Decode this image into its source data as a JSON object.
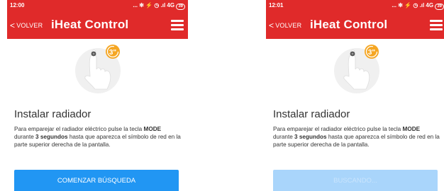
{
  "screens": [
    {
      "status_time": "12:00",
      "status_icons": "... ✻ ⚡ ◷ .ıl 4G",
      "battery": "39",
      "back_label": "VOLVER",
      "app_title": "iHeat Control",
      "badge": "3\"",
      "heading": "Instalar radiador",
      "desc_part1": "Para emparejar el radiador eléctrico pulse la tecla ",
      "desc_mode": "MODE",
      "desc_part2": " durante ",
      "desc_seconds": "3 segundos",
      "desc_part3": " hasta que aparezca el símbolo de red en la parte superior derecha de la pantalla.",
      "button_label": "COMENZAR BÚSQUEDA",
      "button_state": "enabled"
    },
    {
      "status_time": "12:01",
      "status_icons": "... ✻ ⚡ ◷ .ıl 4G",
      "battery": "39",
      "back_label": "VOLVER",
      "app_title": "iHeat Control",
      "badge": "3\"",
      "heading": "Instalar radiador",
      "desc_part1": "Para emparejar el radiador eléctrico pulse la tecla ",
      "desc_mode": "MODE",
      "desc_part2": " durante ",
      "desc_seconds": "3 segundos",
      "desc_part3": " hasta que aparezca el símbolo de red en la parte superior derecha de la pantalla.",
      "button_label": "BUSCANDO...",
      "button_state": "disabled"
    }
  ],
  "colors": {
    "header": "#e02a2a",
    "button_active": "#2196f3",
    "button_disabled": "#a9d5fb",
    "badge": "#f5a623"
  }
}
